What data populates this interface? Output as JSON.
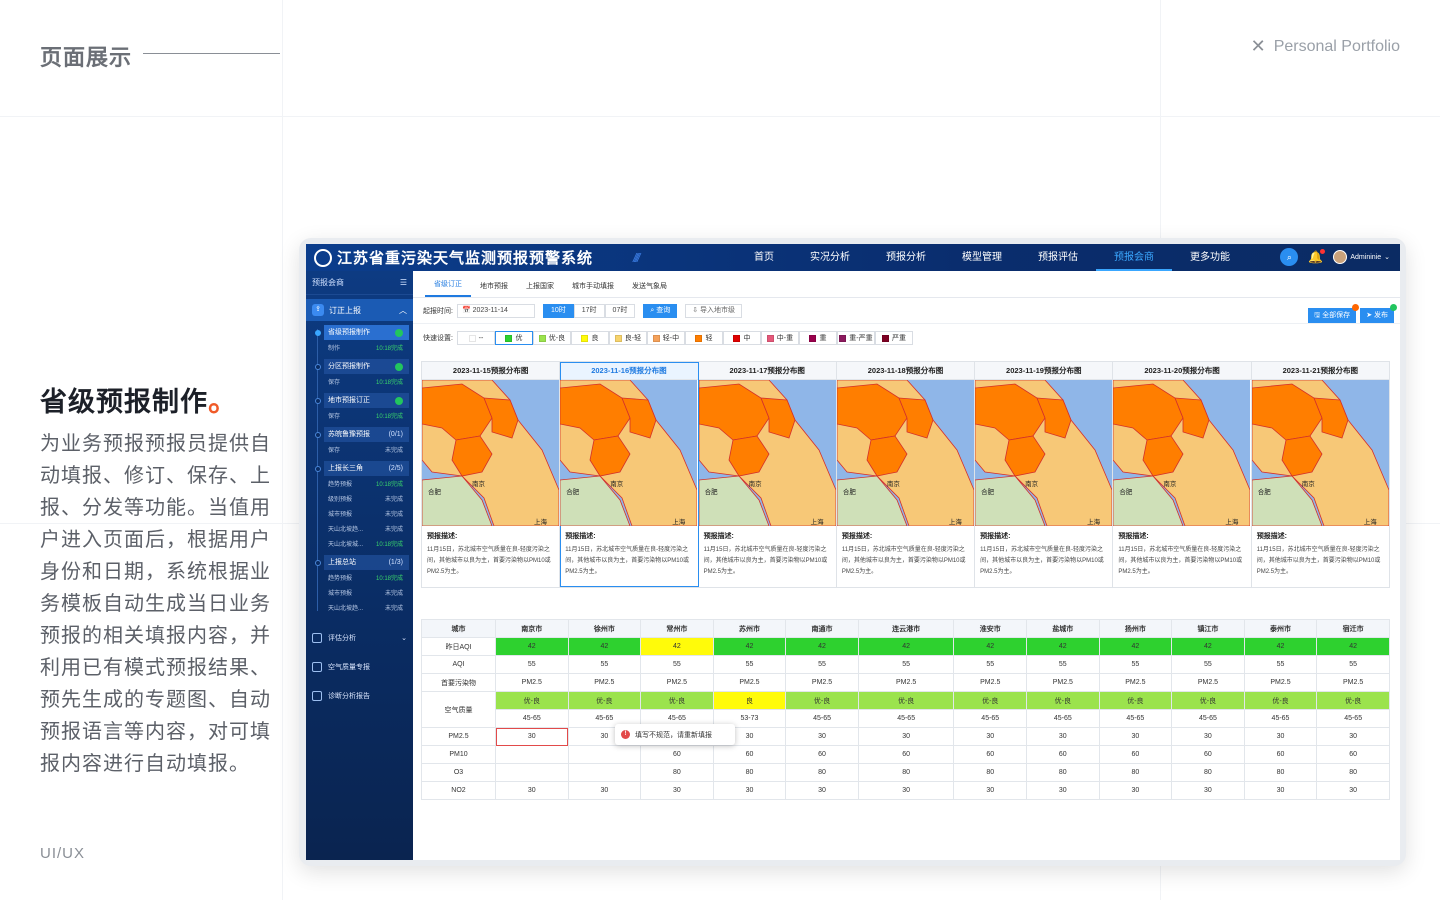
{
  "portfolio": {
    "section_title": "页面展示",
    "brand": "Personal Portfolio",
    "close_glyph": "✕",
    "heading": "省级预报制作",
    "heading_dot": "。",
    "description": "为业务预报预报员提供自动填报、修订、保存、上报、分发等功能。当值用户进入页面后，根据用户身份和日期，系统根据业务模板自动生成当日业务预报的相关填报内容，并利用已有模式预报结果、预先生成的专题图、自动预报语言等内容，对可填报内容进行自动填报。",
    "tag": "UI/UX"
  },
  "app": {
    "title": "江苏省重污染天气监测预报预警系统",
    "nav": [
      "首页",
      "实况分析",
      "预报分析",
      "模型管理",
      "预报评估",
      "预报会商",
      "更多功能"
    ],
    "nav_active_index": 5,
    "user_name": "Admininie",
    "sidebar": {
      "title": "预报会商",
      "group": "订正上报",
      "steps": [
        {
          "name": "省级预报制作",
          "current": true,
          "status_icon": "check-icon",
          "subs": [
            {
              "label": "制作",
              "status": "10:18完成",
              "done": true
            }
          ]
        },
        {
          "name": "分区预报制作",
          "status_icon": "check-icon",
          "subs": [
            {
              "label": "保存",
              "status": "10:18完成",
              "done": true
            }
          ]
        },
        {
          "name": "地市预报订正",
          "status_icon": "check-icon",
          "subs": [
            {
              "label": "保存",
              "status": "10:18完成",
              "done": true
            }
          ]
        },
        {
          "name": "苏皖鲁豫预报",
          "count": "(0/1)",
          "subs": [
            {
              "label": "保存",
              "status": "未完成",
              "done": false
            }
          ]
        },
        {
          "name": "上报长三角",
          "count": "(2/5)",
          "subs": [
            {
              "label": "趋势预报",
              "status": "10:18完成",
              "done": true
            },
            {
              "label": "级别预报",
              "status": "未完成",
              "done": false
            },
            {
              "label": "城市预报",
              "status": "未完成",
              "done": false
            },
            {
              "label": "天山北坡趋...",
              "status": "未完成",
              "done": false
            },
            {
              "label": "天山北坡城...",
              "status": "10:18完成",
              "done": true
            }
          ]
        },
        {
          "name": "上报总站",
          "count": "(1/3)",
          "subs": [
            {
              "label": "趋势预报",
              "status": "10:18完成",
              "done": true
            },
            {
              "label": "城市预报",
              "status": "未完成",
              "done": false
            },
            {
              "label": "天山北坡趋...",
              "status": "未完成",
              "done": false
            }
          ]
        }
      ],
      "menu": [
        "评估分析",
        "空气质量专报",
        "诊断分析报告"
      ]
    },
    "subtabs": [
      "省级订正",
      "地市预报",
      "上报国家",
      "城市手动填报",
      "发送气象局"
    ],
    "subtab_active_index": 0,
    "filter": {
      "label": "起报时间:",
      "date": "2023-11-14",
      "hours": [
        "10时",
        "17时",
        "07时"
      ],
      "hour_active_index": 0,
      "query": "查询",
      "import": "导入地市级",
      "save_all": "全部保存",
      "publish": "发布"
    },
    "legend": {
      "label": "快速设置:",
      "items": [
        {
          "label": "--",
          "color": "#ffffff"
        },
        {
          "label": "优",
          "color": "#2ed12f"
        },
        {
          "label": "优-良",
          "color": "#9be34d"
        },
        {
          "label": "良",
          "color": "#fffb0a"
        },
        {
          "label": "良-轻",
          "color": "#f7d36b"
        },
        {
          "label": "轻-中",
          "color": "#f5a15a"
        },
        {
          "label": "轻",
          "color": "#ff7e00"
        },
        {
          "label": "中",
          "color": "#e00000"
        },
        {
          "label": "中-重",
          "color": "#e5587a"
        },
        {
          "label": "重",
          "color": "#99004c"
        },
        {
          "label": "重-严重",
          "color": "#8c1a5e"
        },
        {
          "label": "严重",
          "color": "#7e0023"
        }
      ],
      "selected_index": 1
    },
    "maps": [
      {
        "title": "2023-11-15预报分布图"
      },
      {
        "title": "2023-11-16预报分布图",
        "selected": true
      },
      {
        "title": "2023-11-17预报分布图"
      },
      {
        "title": "2023-11-18预报分布图"
      },
      {
        "title": "2023-11-19预报分布图"
      },
      {
        "title": "2023-11-20预报分布图"
      },
      {
        "title": "2023-11-21预报分布图"
      }
    ],
    "map_labels": {
      "hefei": "合肥",
      "nanjing": "南京",
      "shanghai": "上海"
    },
    "map_desc_title": "预报描述:",
    "map_desc": "11月15日，苏北城市空气质量在良-轻度污染之间，其他城市以良为主，首要污染物以PM10或PM2.5为主。",
    "colors": {
      "heavy": "#ff7e00",
      "light": "#f7c877",
      "water": "#8fb6e8",
      "land": "#cfe0b8",
      "border": "#d4302a"
    },
    "table": {
      "header": [
        "城市",
        "南京市",
        "徐州市",
        "常州市",
        "苏州市",
        "南通市",
        "连云港市",
        "淮安市",
        "盐城市",
        "扬州市",
        "镇江市",
        "泰州市",
        "宿迁市"
      ],
      "yesterday_aqi_label": "昨日AQI",
      "yesterday_aqi": [
        "42",
        "42",
        "42",
        "42",
        "42",
        "42",
        "42",
        "42",
        "42",
        "42",
        "42",
        "42"
      ],
      "yesterday_aqi_colors": [
        "green",
        "green",
        "yellow",
        "green",
        "green",
        "green",
        "green",
        "green",
        "green",
        "green",
        "green",
        "green"
      ],
      "aqi_label": "AQI",
      "aqi": [
        "55",
        "55",
        "55",
        "55",
        "55",
        "55",
        "55",
        "55",
        "55",
        "55",
        "55",
        "55"
      ],
      "pollutant_label": "首要污染物",
      "pollutant": [
        "PM2.5",
        "PM2.5",
        "PM2.5",
        "PM2.5",
        "PM2.5",
        "PM2.5",
        "PM2.5",
        "PM2.5",
        "PM2.5",
        "PM2.5",
        "PM2.5",
        "PM2.5"
      ],
      "quality_label": "空气质量",
      "quality": [
        "优-良",
        "优-良",
        "优-良",
        "良",
        "优-良",
        "优-良",
        "优-良",
        "优-良",
        "优-良",
        "优-良",
        "优-良",
        "优-良"
      ],
      "quality_colors": [
        "lgreen",
        "lgreen",
        "lgreen",
        "yellow",
        "lgreen",
        "lgreen",
        "lgreen",
        "lgreen",
        "lgreen",
        "lgreen",
        "lgreen",
        "lgreen"
      ],
      "range": [
        "45-65",
        "45-65",
        "45-65",
        "53-73",
        "45-65",
        "45-65",
        "45-65",
        "45-65",
        "45-65",
        "45-65",
        "45-65",
        "45-65"
      ],
      "pm25_label": "PM2.5",
      "pm25": [
        "30",
        "30",
        "30",
        "30",
        "30",
        "30",
        "30",
        "30",
        "30",
        "30",
        "30",
        "30"
      ],
      "pm10_label": "PM10",
      "pm10": [
        "",
        "",
        "60",
        "60",
        "60",
        "60",
        "60",
        "60",
        "60",
        "60",
        "60",
        "60"
      ],
      "o3_label": "O3",
      "o3": [
        "",
        "",
        "80",
        "80",
        "80",
        "80",
        "80",
        "80",
        "80",
        "80",
        "80",
        "80"
      ],
      "no2_label": "NO2",
      "no2": [
        "30",
        "30",
        "30",
        "30",
        "30",
        "30",
        "30",
        "30",
        "30",
        "30",
        "30",
        "30"
      ],
      "error_tip": "填写不规范，请重新填报"
    }
  }
}
